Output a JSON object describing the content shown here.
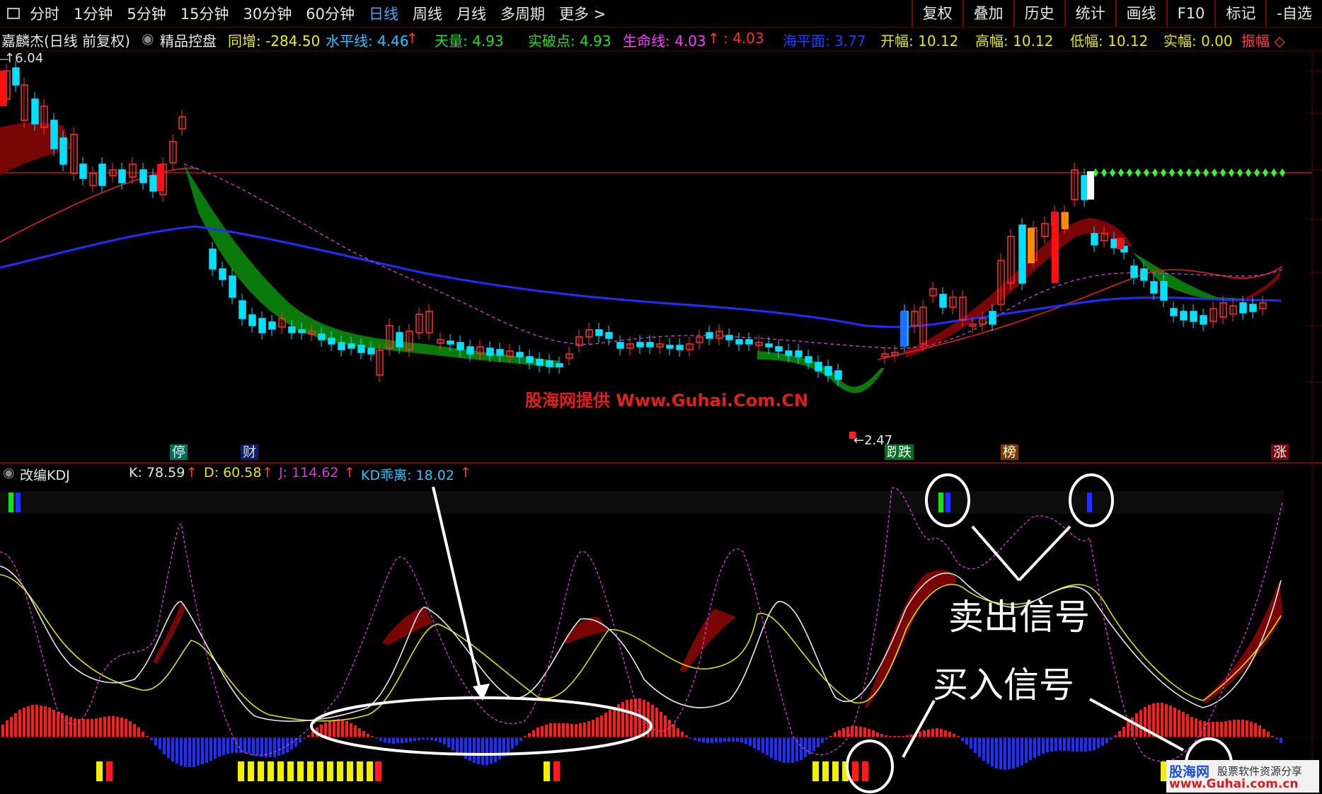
{
  "toolbar": {
    "periods": [
      "分时",
      "1分钟",
      "5分钟",
      "15分钟",
      "30分钟",
      "60分钟",
      "日线",
      "周线",
      "月线",
      "多周期",
      "更多 >"
    ],
    "active_period": "日线",
    "right_tools": [
      "复权",
      "叠加",
      "历史",
      "统计",
      "画线",
      "F10",
      "标记",
      "-自选"
    ]
  },
  "info": {
    "stock": "嘉麟杰(日线 前复权)",
    "indicator": "精品控盘",
    "tongzeng": "同增: -284.50",
    "shuipingxian": "水平线: 4.46",
    "tianliang": "天量: 4.93",
    "shipodian": "实破点: 4.93",
    "shengmingxian": "生命线: 4.03",
    "extra": ": 4.03",
    "haipingmian": "海平面: 3.77",
    "kaifu": "开幅: 10.12",
    "gaofu": "高幅: 10.12",
    "difu": "低幅: 10.12",
    "shifu": "实幅: 0.00",
    "zhenfu": "振幅 ◇"
  },
  "price_labels": {
    "high": "6.04",
    "low": "2.47"
  },
  "markers": {
    "ting": "停",
    "cai": "财",
    "dieting": "跌",
    "bang": "榜",
    "zhang": "涨"
  },
  "watermark_text": "股海网提供 Www.Guhai.Com.CN",
  "kdj": {
    "name": "改编KDJ",
    "k": "K: 78.59",
    "d": "D: 60.58",
    "j": "J: 114.62",
    "kd": "KD乖离: 18.02"
  },
  "annotations": {
    "sell": "卖出信号",
    "buy": "买入信号"
  },
  "corner_logo": {
    "line1": "股海网",
    "line1b": "股票软件资源分享",
    "line2": "www.Guhai.com.cn"
  },
  "colors": {
    "up": "#ff3030",
    "down": "#00e0ff",
    "ma_blue": "#1e2fff",
    "ribbon_green": "#0a7a0a",
    "ribbon_red": "#7a0505",
    "dashed_magenta": "#d040d0"
  }
}
